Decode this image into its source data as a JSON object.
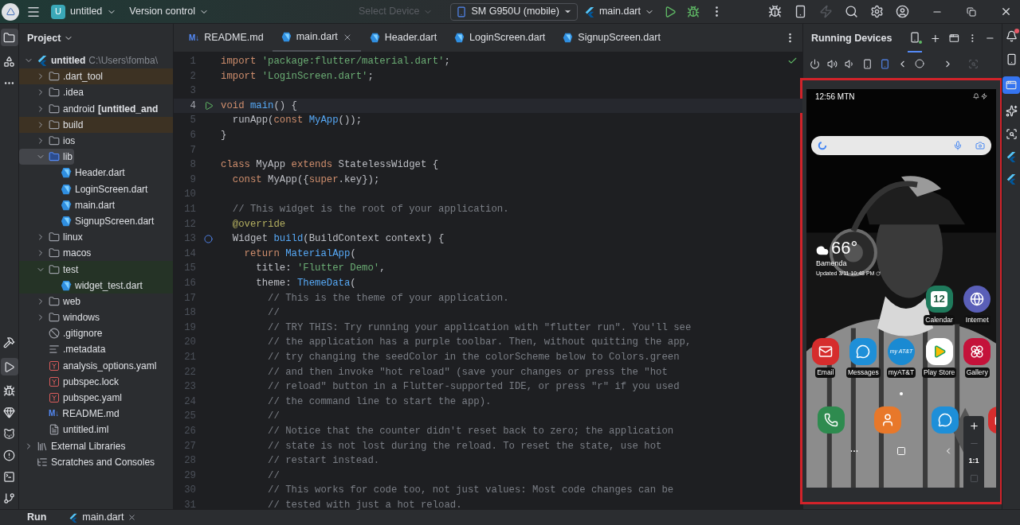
{
  "title_bar": {
    "project_badge": "U",
    "project": "untitled",
    "vcs": "Version control",
    "device_placeholder": "Select Device",
    "device": "SM G950U (mobile)",
    "run_config": "main.dart"
  },
  "project_panel": {
    "title": "Project",
    "tree": [
      {
        "label": "untitled",
        "path": "C:\\Users\\fomba\\",
        "kind": "flutter",
        "expanded": true,
        "selected": false,
        "children": [
          {
            "label": ".dart_tool",
            "kind": "folder",
            "color": "#3d3223",
            "expanded": false,
            "selected": false
          },
          {
            "label": ".idea",
            "kind": "folder",
            "expanded": false,
            "selected": false
          },
          {
            "label": "android",
            "module": "[untitled_and",
            "kind": "folder",
            "expanded": false,
            "selected": false
          },
          {
            "label": "build",
            "kind": "folder",
            "color": "#3d3223",
            "expanded": false,
            "selected": false
          },
          {
            "label": "ios",
            "kind": "folder",
            "expanded": false,
            "selected": false
          },
          {
            "label": "lib",
            "kind": "source",
            "expanded": true,
            "selected": true,
            "children": [
              {
                "label": "Header.dart",
                "kind": "dart",
                "selected": false
              },
              {
                "label": "LoginScreen.dart",
                "kind": "dart",
                "selected": false
              },
              {
                "label": "main.dart",
                "kind": "dart",
                "selected": false
              },
              {
                "label": "SignupScreen.dart",
                "kind": "dart",
                "selected": false
              }
            ]
          },
          {
            "label": "linux",
            "kind": "folder",
            "expanded": false,
            "selected": false
          },
          {
            "label": "macos",
            "kind": "folder",
            "expanded": false,
            "selected": false
          },
          {
            "label": "test",
            "kind": "folder",
            "color": "#253326",
            "expanded": true,
            "selected": false,
            "children": [
              {
                "label": "widget_test.dart",
                "kind": "dart",
                "color": "#253326",
                "selected": false
              }
            ]
          },
          {
            "label": "web",
            "kind": "folder",
            "expanded": false,
            "selected": false
          },
          {
            "label": "windows",
            "kind": "folder",
            "expanded": false,
            "selected": false
          },
          {
            "label": ".gitignore",
            "kind": "ignore",
            "selected": false
          },
          {
            "label": ".metadata",
            "kind": "text",
            "selected": false
          },
          {
            "label": "analysis_options.yaml",
            "kind": "yaml",
            "selected": false
          },
          {
            "label": "pubspec.lock",
            "kind": "yaml",
            "selected": false
          },
          {
            "label": "pubspec.yaml",
            "kind": "yaml",
            "selected": false
          },
          {
            "label": "README.md",
            "kind": "md",
            "icon_label": "M↓",
            "selected": false
          },
          {
            "label": "untitled.iml",
            "kind": "iml",
            "selected": false
          }
        ]
      },
      {
        "label": "External Libraries",
        "kind": "libs",
        "expanded": false,
        "selected": false
      },
      {
        "label": "Scratches and Consoles",
        "kind": "scratches",
        "selected": false
      }
    ]
  },
  "editor_tabs": [
    {
      "label": "README.md",
      "kind": "md",
      "icon_label": "M↓",
      "selected": false
    },
    {
      "label": "main.dart",
      "kind": "dart",
      "selected": true
    },
    {
      "label": "Header.dart",
      "kind": "dart",
      "selected": false
    },
    {
      "label": "LoginScreen.dart",
      "kind": "dart",
      "selected": false
    },
    {
      "label": "SignupScreen.dart",
      "kind": "dart",
      "selected": false
    }
  ],
  "code": [
    {
      "number": "1",
      "kind": "code",
      "tokens": [
        {
          "kind": "kw",
          "text": "import "
        },
        {
          "kind": "str",
          "text": "'package:flutter/material.dart'"
        },
        {
          "kind": "plain",
          "text": ";"
        }
      ]
    },
    {
      "number": "2",
      "kind": "code",
      "tokens": [
        {
          "kind": "kw",
          "text": "import "
        },
        {
          "kind": "str",
          "text": "'LoginScreen.dart'"
        },
        {
          "kind": "plain",
          "text": ";"
        }
      ]
    },
    {
      "number": "3",
      "kind": "code"
    },
    {
      "number": "4",
      "kind": "run",
      "current": true,
      "tokens": [
        {
          "kind": "kw",
          "text": "void "
        },
        {
          "kind": "fn",
          "text": "main"
        },
        {
          "kind": "plain",
          "text": "() {"
        }
      ]
    },
    {
      "number": "5",
      "kind": "code",
      "tokens": [
        {
          "kind": "plain",
          "text": "  runApp("
        },
        {
          "kind": "kw",
          "text": "const "
        },
        {
          "kind": "fn",
          "text": "MyApp"
        },
        {
          "kind": "plain",
          "text": "());"
        }
      ]
    },
    {
      "number": "6",
      "kind": "code",
      "tokens": [
        {
          "kind": "plain",
          "text": "}"
        }
      ]
    },
    {
      "number": "7",
      "kind": "code"
    },
    {
      "number": "8",
      "kind": "code",
      "tokens": [
        {
          "kind": "kw",
          "text": "class "
        },
        {
          "kind": "plain",
          "text": "MyApp "
        },
        {
          "kind": "kw",
          "text": "extends "
        },
        {
          "kind": "plain",
          "text": "StatelessWidget {"
        }
      ]
    },
    {
      "number": "9",
      "kind": "code",
      "tokens": [
        {
          "kind": "kw",
          "text": "  const "
        },
        {
          "kind": "plain",
          "text": "MyApp({"
        },
        {
          "kind": "kw",
          "text": "super"
        },
        {
          "kind": "plain",
          "text": ".key});"
        }
      ]
    },
    {
      "number": "10",
      "kind": "code"
    },
    {
      "number": "11",
      "kind": "code",
      "tokens": [
        {
          "kind": "comment",
          "text": "  // This widget is the root of your application."
        }
      ]
    },
    {
      "number": "12",
      "kind": "code",
      "tokens": [
        {
          "kind": "ann",
          "text": "  @override"
        }
      ]
    },
    {
      "number": "13",
      "kind": "override",
      "tokens": [
        {
          "kind": "plain",
          "text": "  Widget "
        },
        {
          "kind": "fn",
          "text": "build"
        },
        {
          "kind": "plain",
          "text": "(BuildContext context) {"
        }
      ]
    },
    {
      "number": "14",
      "kind": "code",
      "tokens": [
        {
          "kind": "kw",
          "text": "    return "
        },
        {
          "kind": "fn",
          "text": "MaterialApp"
        },
        {
          "kind": "plain",
          "text": "("
        }
      ]
    },
    {
      "number": "15",
      "kind": "code",
      "tokens": [
        {
          "kind": "plain",
          "text": "      title: "
        },
        {
          "kind": "str",
          "text": "'Flutter Demo'"
        },
        {
          "kind": "plain",
          "text": ","
        }
      ]
    },
    {
      "number": "16",
      "kind": "code",
      "tokens": [
        {
          "kind": "plain",
          "text": "      theme: "
        },
        {
          "kind": "fn",
          "text": "ThemeData"
        },
        {
          "kind": "plain",
          "text": "("
        }
      ]
    },
    {
      "number": "17",
      "kind": "code",
      "tokens": [
        {
          "kind": "comment",
          "text": "        // This is the theme of your application."
        }
      ]
    },
    {
      "number": "18",
      "kind": "code",
      "tokens": [
        {
          "kind": "comment",
          "text": "        //"
        }
      ]
    },
    {
      "number": "19",
      "kind": "code",
      "tokens": [
        {
          "kind": "comment",
          "text": "        // TRY THIS: Try running your application with \"flutter run\". You'll see"
        }
      ]
    },
    {
      "number": "20",
      "kind": "code",
      "tokens": [
        {
          "kind": "comment",
          "text": "        // the application has a purple toolbar. Then, without quitting the app,"
        }
      ]
    },
    {
      "number": "21",
      "kind": "code",
      "tokens": [
        {
          "kind": "comment",
          "text": "        // try changing the seedColor in the colorScheme below to Colors.green"
        }
      ]
    },
    {
      "number": "22",
      "kind": "code",
      "tokens": [
        {
          "kind": "comment",
          "text": "        // and then invoke \"hot reload\" (save your changes or press the \"hot"
        }
      ]
    },
    {
      "number": "23",
      "kind": "code",
      "tokens": [
        {
          "kind": "comment",
          "text": "        // reload\" button in a Flutter-supported IDE, or press \"r\" if you used"
        }
      ]
    },
    {
      "number": "24",
      "kind": "code",
      "tokens": [
        {
          "kind": "comment",
          "text": "        // the command line to start the app)."
        }
      ]
    },
    {
      "number": "25",
      "kind": "code",
      "tokens": [
        {
          "kind": "comment",
          "text": "        //"
        }
      ]
    },
    {
      "number": "26",
      "kind": "code",
      "tokens": [
        {
          "kind": "comment",
          "text": "        // Notice that the counter didn't reset back to zero; the application"
        }
      ]
    },
    {
      "number": "27",
      "kind": "code",
      "tokens": [
        {
          "kind": "comment",
          "text": "        // state is not lost during the reload. To reset the state, use hot"
        }
      ]
    },
    {
      "number": "28",
      "kind": "code",
      "tokens": [
        {
          "kind": "comment",
          "text": "        // restart instead."
        }
      ]
    },
    {
      "number": "29",
      "kind": "code",
      "tokens": [
        {
          "kind": "comment",
          "text": "        //"
        }
      ]
    },
    {
      "number": "30",
      "kind": "code",
      "tokens": [
        {
          "kind": "comment",
          "text": "        // This works for code too, not just values: Most code changes can be"
        }
      ]
    },
    {
      "number": "31",
      "kind": "code",
      "tokens": [
        {
          "kind": "comment",
          "text": "        // tested with just a hot reload."
        }
      ]
    }
  ],
  "running_devices": {
    "title": "Running Devices",
    "phone": {
      "status_time": "12:56 MTN",
      "weather": {
        "temperature": "66°",
        "city": "Bamenda",
        "updated": "Updated 3/11 10:48 PM"
      },
      "app_rows": [
        [
          {
            "kind": "calendar",
            "label": "Calendar",
            "badge": "12"
          },
          {
            "kind": "internet",
            "label": "Internet"
          }
        ],
        [
          {
            "kind": "email",
            "label": "Email"
          },
          {
            "kind": "messages",
            "label": "Messages"
          },
          {
            "kind": "att",
            "label": "myAT&T",
            "badge": "my AT&T"
          },
          {
            "kind": "play",
            "label": "Play Store"
          },
          {
            "kind": "gallery",
            "label": "Gallery"
          }
        ]
      ],
      "dock": [
        {
          "kind": "phone"
        },
        {
          "kind": "contacts"
        },
        {
          "kind": "messages"
        },
        {
          "kind": "camera"
        }
      ],
      "zoom_reset": "1:1"
    }
  },
  "bottom_bar": {
    "title": "Run",
    "tab": "main.dart"
  }
}
